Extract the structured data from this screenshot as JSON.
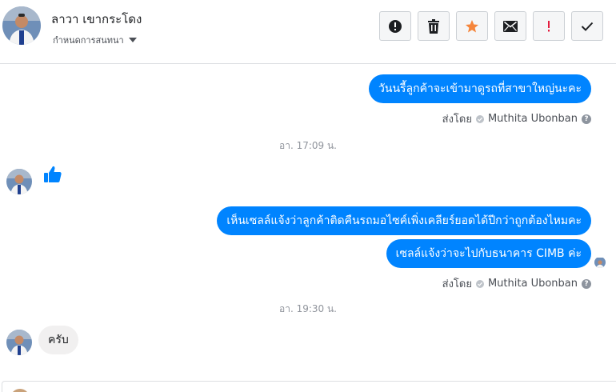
{
  "header": {
    "contact_name": "ลาวา เขากระโดง",
    "conversation_settings": "กำหนดการสนทนา",
    "actions": [
      {
        "name": "report-spam-button",
        "icon": "alert-circle-icon"
      },
      {
        "name": "delete-button",
        "icon": "trash-icon"
      },
      {
        "name": "star-button",
        "icon": "star-icon"
      },
      {
        "name": "mark-unread-button",
        "icon": "envelope-icon"
      },
      {
        "name": "follow-up-button",
        "icon": "exclamation-icon"
      },
      {
        "name": "mark-done-button",
        "icon": "checkmark-icon"
      }
    ]
  },
  "thread": {
    "msg1": "วันนรี้ลูกค้าจะเข้ามาดูรถที่สาขาใหญ่นะคะ",
    "sent_by_label": "ส่งโดย",
    "sender_name": "Muthita Ubonban",
    "time1": "อา. 17:09 น.",
    "like_reaction": "thumbs-up-icon",
    "msg2": "เห็นเซลล์แจ้งว่าลูกค้าติดคืนรถมอไซค์เพิ่งเคลียร์ยอดได้ปีกว่าถูกต้องไหมคะ",
    "msg3": "เซลล์แจ้งว่าจะไปกับธนาคาร CIMB ค่ะ",
    "time2": "อา. 19:30 น.",
    "reply": "ครับ"
  },
  "colors": {
    "outgoing_bubble": "#0084ff",
    "incoming_bubble": "#f1f0f0",
    "star": "#f5853b",
    "follow_up": "#e41e3f",
    "like": "#0084ff"
  }
}
